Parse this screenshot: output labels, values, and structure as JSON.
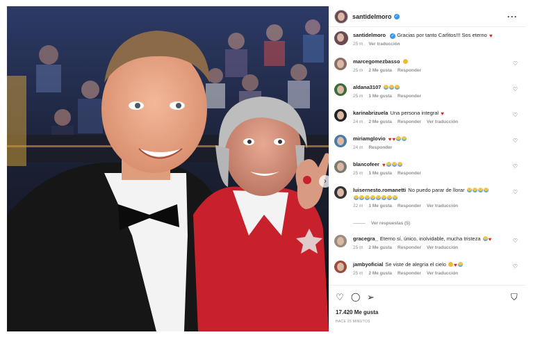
{
  "photo": {
    "next_icon": "chevron-right-icon"
  },
  "header": {
    "username": "santidelmoro",
    "more_icon": "more-horizontal-icon"
  },
  "caption": {
    "username": "santidelmoro",
    "text": "Gracias por tanto Carlitos!!! Sos eterno",
    "time": "25 m",
    "translate": "Ver traducción"
  },
  "comments": [
    {
      "username": "marcegomezbasso",
      "text": "",
      "time": "25 m",
      "likes": "2 Me gusta",
      "reply": "Responder",
      "translate": ""
    },
    {
      "username": "aldana3107",
      "text": "",
      "time": "25 m",
      "likes": "1 Me gusta",
      "reply": "Responder",
      "translate": ""
    },
    {
      "username": "karinabrizuela",
      "text": "Una persona integral",
      "time": "24 m",
      "likes": "2 Me gusta",
      "reply": "Responder",
      "translate": "Ver traducción"
    },
    {
      "username": "miriamglovio",
      "text": "",
      "time": "24 m",
      "likes": "",
      "reply": "Responder",
      "translate": ""
    },
    {
      "username": "blancofeer",
      "text": "",
      "time": "25 m",
      "likes": "1 Me gusta",
      "reply": "Responder",
      "translate": ""
    },
    {
      "username": "luisernesto.romanetti",
      "text": "No puedo parar de llorar",
      "time": "22 m",
      "likes": "1 Me gusta",
      "reply": "Responder",
      "translate": "Ver traducción"
    },
    {
      "username": "gracegra_",
      "text": "Eterno sí, único, inolvidable, mucha tristeza",
      "time": "25 m",
      "likes": "2 Me gusta",
      "reply": "Responder",
      "translate": "Ver traducción"
    },
    {
      "username": "jambyoficial",
      "text": "Se viste de alegría el cielo",
      "time": "25 m",
      "likes": "2 Me gusta",
      "reply": "Responder",
      "translate": "Ver traducción"
    }
  ],
  "view_replies": "Ver respuestas (5)",
  "actions": {
    "likes": "17.420 Me gusta",
    "time": "HACE 25 MINUTOS",
    "icons": [
      "heart-icon",
      "comment-icon",
      "share-icon",
      "bookmark-icon"
    ]
  }
}
